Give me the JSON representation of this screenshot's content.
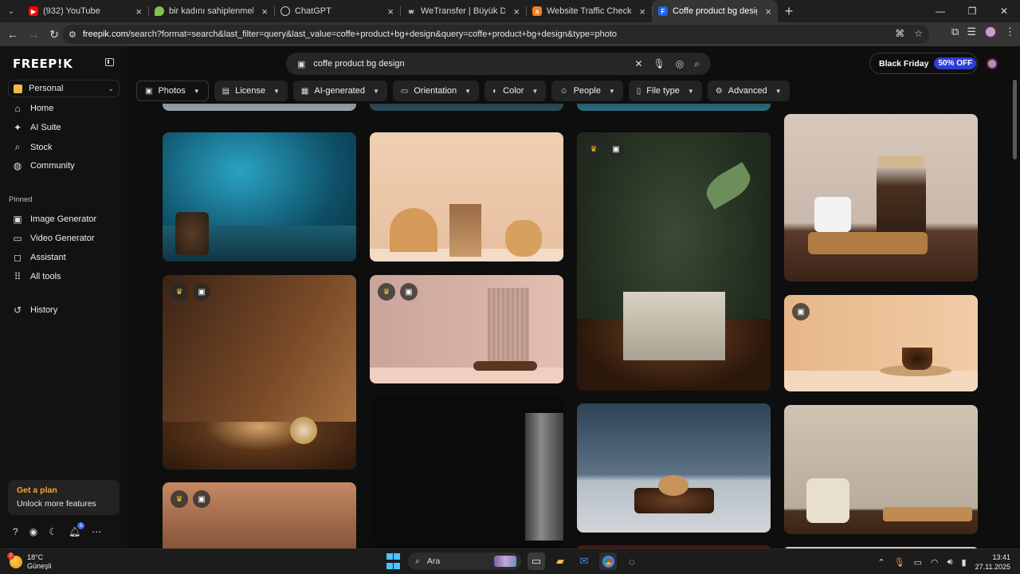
{
  "browser": {
    "tabs": [
      {
        "title": "(932) YouTube",
        "favicon": "youtube-icon",
        "color": "#ff0000",
        "active": false
      },
      {
        "title": "bir kadını sahiplenmek - ekşi sö",
        "favicon": "eksi-drop-icon",
        "color": "#81c14b",
        "active": false
      },
      {
        "title": "ChatGPT",
        "favicon": "chatgpt-icon",
        "color": "#cccccc",
        "active": false
      },
      {
        "title": "WeTransfer | Büyük Dosyalan H",
        "favicon": "wetransfer-icon",
        "color": "#222222",
        "active": false
      },
      {
        "title": "Website Traffic Checker: Estima",
        "favicon": "ahrefs-icon",
        "color": "#f5801f",
        "active": false
      },
      {
        "title": "Coffe product bg design Photo",
        "favicon": "freepik-icon",
        "color": "#1e64f0",
        "active": true
      }
    ],
    "url_host": "freepik.com",
    "url_path": "/search?format=search&last_filter=query&last_value=coffe+product+bg+design&query=coffe+product+bg+design&type=photo"
  },
  "sidebar": {
    "logo": "FREEP!K",
    "workspace": "Personal",
    "items": [
      {
        "label": "Home",
        "icon": "home-icon"
      },
      {
        "label": "AI Suite",
        "icon": "sparkle-icon"
      },
      {
        "label": "Stock",
        "icon": "search-icon"
      },
      {
        "label": "Community",
        "icon": "globe-icon"
      }
    ],
    "pinned_heading": "Pinned",
    "pinned": [
      {
        "label": "Image Generator",
        "icon": "image-icon"
      },
      {
        "label": "Video Generator",
        "icon": "video-icon"
      },
      {
        "label": "Assistant",
        "icon": "assistant-icon"
      },
      {
        "label": "All tools",
        "icon": "grid-icon"
      }
    ],
    "history": "History",
    "plan": {
      "title": "Get a plan",
      "subtitle": "Unlock more features"
    },
    "notifications_count": "8"
  },
  "search": {
    "query": "coffe product bg design"
  },
  "promo": {
    "label": "Black Friday",
    "badge": "50% OFF"
  },
  "filters": [
    {
      "label": "Photos",
      "icon": "photo-icon"
    },
    {
      "label": "License",
      "icon": "license-icon"
    },
    {
      "label": "AI-generated",
      "icon": "ai-icon"
    },
    {
      "label": "Orientation",
      "icon": "orientation-icon"
    },
    {
      "label": "Color",
      "icon": "palette-icon"
    },
    {
      "label": "People",
      "icon": "people-icon"
    },
    {
      "label": "File type",
      "icon": "file-icon"
    },
    {
      "label": "Advanced",
      "icon": "settings-icon"
    }
  ],
  "results": [
    {
      "name": "teal-texture-coffee-jar",
      "premium": false,
      "ai": false
    },
    {
      "name": "beige-vase-coffee-scene",
      "premium": false,
      "ai": false
    },
    {
      "name": "green-leaves-stone-cube",
      "premium": true,
      "ai": true
    },
    {
      "name": "coffee-jar-cup-board",
      "premium": false,
      "ai": false
    },
    {
      "name": "watch-on-coffee-beans",
      "premium": true,
      "ai": true
    },
    {
      "name": "pink-panel-coffee-beans",
      "premium": true,
      "ai": true
    },
    {
      "name": "espresso-cup-warm-backdrop",
      "premium": false,
      "ai": true
    },
    {
      "name": "moka-pot-dark",
      "premium": false,
      "ai": false
    },
    {
      "name": "cookie-on-beans-blue-wall",
      "premium": false,
      "ai": false
    },
    {
      "name": "coffee-sack-board",
      "premium": false,
      "ai": false
    },
    {
      "name": "brown-gradient-backdrop",
      "premium": true,
      "ai": true
    }
  ],
  "taskbar": {
    "temperature": "18°C",
    "weather": "Güneşli",
    "weather_badge": "2",
    "search_placeholder": "Ara",
    "time": "13:41",
    "date": "27.11.2025"
  }
}
